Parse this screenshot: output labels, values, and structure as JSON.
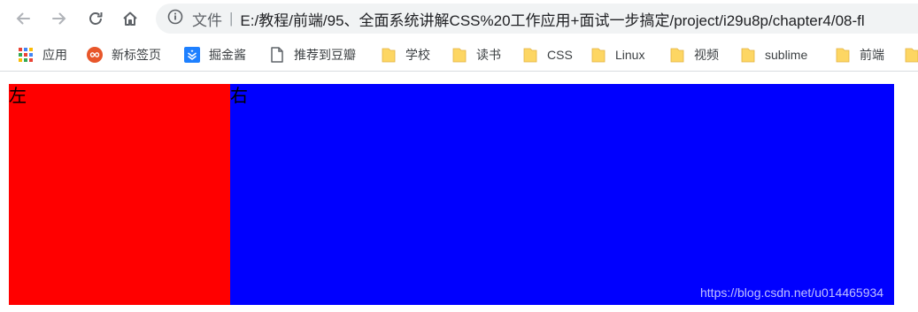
{
  "browser": {
    "back_icon": "arrow-left-icon",
    "forward_icon": "arrow-right-icon",
    "reload_icon": "reload-icon",
    "home_icon": "home-icon",
    "address": {
      "info_icon": "info-icon",
      "scheme_label": "文件",
      "separator": "|",
      "url": "E:/教程/前端/95、全面系统讲解CSS%20工作应用+面试一步搞定/project/i29u8p/chapter4/08-fl"
    }
  },
  "bookmarks": [
    {
      "label": "应用",
      "icon": "apps-grid-icon"
    },
    {
      "label": "新标签页",
      "icon": "infinity-icon"
    },
    {
      "label": "掘金酱",
      "icon": "juejin-icon"
    },
    {
      "label": "推荐到豆瓣",
      "icon": "page-icon"
    },
    {
      "label": "学校",
      "icon": "folder-icon"
    },
    {
      "label": "读书",
      "icon": "folder-icon"
    },
    {
      "label": "CSS",
      "icon": "folder-icon"
    },
    {
      "label": "Linux",
      "icon": "folder-icon"
    },
    {
      "label": "视频",
      "icon": "folder-icon"
    },
    {
      "label": "sublime",
      "icon": "folder-icon"
    },
    {
      "label": "前端",
      "icon": "folder-icon"
    }
  ],
  "page": {
    "left_text": "左",
    "right_text": "右",
    "left_color": "#ff0000",
    "right_color": "#0000ff",
    "watermark": "https://blog.csdn.net/u014465934"
  },
  "colors": {
    "omnibox_bg": "#f1f3f4",
    "folder": "#fdd663",
    "toolbar_icon": "#5f6368"
  }
}
